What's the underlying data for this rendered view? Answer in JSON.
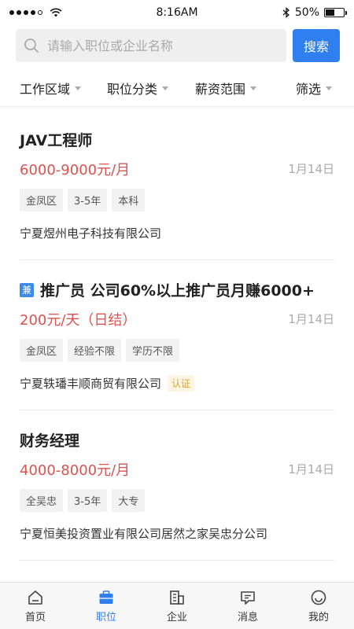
{
  "status_bar": {
    "time": "8:16AM",
    "battery_text": "50%",
    "battery_level": 0.5,
    "signal_bars": 4,
    "signal_max": 5
  },
  "search": {
    "placeholder": "请输入职位或企业名称",
    "button_label": "搜索",
    "accent_color": "#2f7ff0"
  },
  "filters": [
    {
      "label": "工作区域"
    },
    {
      "label": "职位分类"
    },
    {
      "label": "薪资范围"
    },
    {
      "label": "筛选"
    }
  ],
  "jobs": [
    {
      "title": "JAV工程师",
      "part_time": false,
      "salary": "6000-9000元/月",
      "date": "1月14日",
      "tags": [
        "金凤区",
        "3-5年",
        "本科"
      ],
      "company": "宁夏煜州电子科技有限公司",
      "verified": false
    },
    {
      "title": "推广员 公司60%以上推广员月赚6000+",
      "part_time": true,
      "part_time_label": "兼",
      "salary": "200元/天（日结）",
      "date": "1月14日",
      "tags": [
        "金凤区",
        "经验不限",
        "学历不限"
      ],
      "company": "宁夏轶璠丰顺商贸有限公司",
      "verified": true,
      "verified_label": "认证"
    },
    {
      "title": "财务经理",
      "part_time": false,
      "salary": "4000-8000元/月",
      "date": "1月14日",
      "tags": [
        "全吴忠",
        "3-5年",
        "大专"
      ],
      "company": "宁夏恒美投资置业有限公司居然之家吴忠分公司",
      "verified": false
    }
  ],
  "bottom_nav": [
    {
      "label": "首页",
      "icon": "home-icon",
      "active": false
    },
    {
      "label": "职位",
      "icon": "briefcase-icon",
      "active": true
    },
    {
      "label": "企业",
      "icon": "building-icon",
      "active": false
    },
    {
      "label": "消息",
      "icon": "message-icon",
      "active": false
    },
    {
      "label": "我的",
      "icon": "profile-icon",
      "active": false
    }
  ],
  "colors": {
    "salary": "#d9534f",
    "active_nav": "#2f7ff0",
    "part_time_badge": "#3d8be8"
  }
}
